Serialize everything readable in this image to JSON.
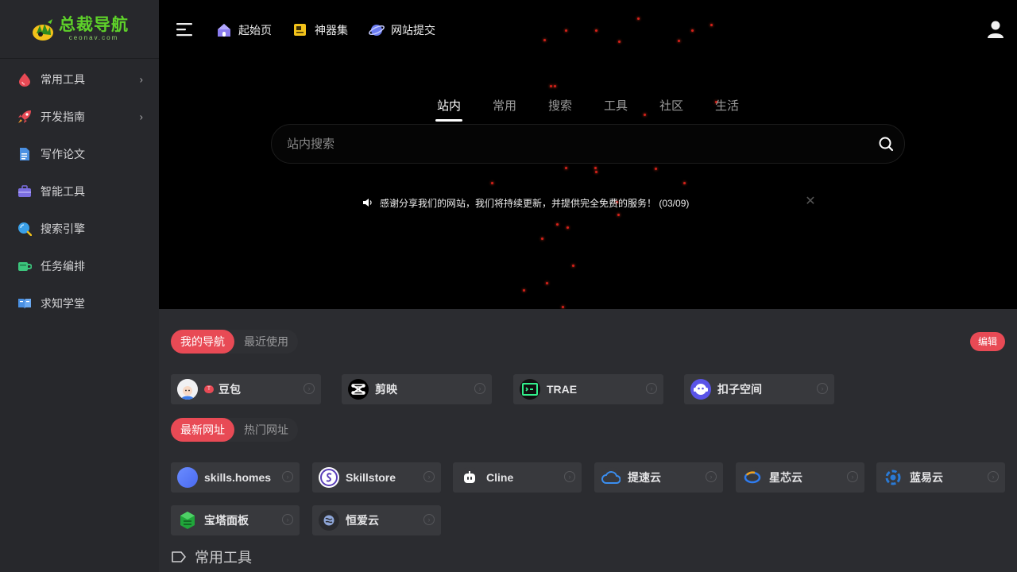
{
  "logo": {
    "title": "总裁导航",
    "subtitle": "ceonav.com"
  },
  "sidebar": {
    "items": [
      {
        "label": "常用工具",
        "icon": "drop-icon",
        "color": "#e84a55",
        "has_submenu": true
      },
      {
        "label": "开发指南",
        "icon": "rocket-icon",
        "color": "#e84a55",
        "has_submenu": true
      },
      {
        "label": "写作论文",
        "icon": "document-icon",
        "color": "#4a90e2",
        "has_submenu": false
      },
      {
        "label": "智能工具",
        "icon": "toolbox-icon",
        "color": "#7b6ee0",
        "has_submenu": false
      },
      {
        "label": "搜索引擎",
        "icon": "search-globe-icon",
        "color": "#3aa0e8",
        "has_submenu": false
      },
      {
        "label": "任务编排",
        "icon": "cup-icon",
        "color": "#3cc47c",
        "has_submenu": false
      },
      {
        "label": "求知学堂",
        "icon": "book-icon",
        "color": "#4a90e2",
        "has_submenu": false
      }
    ]
  },
  "topbar": {
    "links": [
      {
        "label": "起始页",
        "icon": "home-icon"
      },
      {
        "label": "神器集",
        "icon": "folder-icon"
      },
      {
        "label": "网站提交",
        "icon": "planet-icon"
      }
    ]
  },
  "search": {
    "tabs": [
      "站内",
      "常用",
      "搜索",
      "工具",
      "社区",
      "生活"
    ],
    "active_tab": "站内",
    "placeholder": "站内搜索"
  },
  "notice": {
    "text": "感谢分享我们的网站，我们将持续更新，并提供完全免费的服务！ (03/09)"
  },
  "my_nav": {
    "tabs": [
      "我的导航",
      "最近使用"
    ],
    "active_tab": "我的导航",
    "edit_label": "编辑",
    "cards": [
      {
        "label": "豆包",
        "icon": "doubao-icon",
        "hot": true
      },
      {
        "label": "剪映",
        "icon": "capcut-icon"
      },
      {
        "label": "TRAE",
        "icon": "trae-icon"
      },
      {
        "label": "扣子空间",
        "icon": "coze-icon"
      }
    ]
  },
  "sites": {
    "tabs": [
      "最新网址",
      "热门网址"
    ],
    "active_tab": "最新网址",
    "cards": [
      {
        "label": "skills.homes",
        "icon": "skills-homes-icon"
      },
      {
        "label": "Skillstore",
        "icon": "skillstore-icon"
      },
      {
        "label": "Cline",
        "icon": "cline-icon"
      },
      {
        "label": "提速云",
        "icon": "cloud-icon"
      },
      {
        "label": "星芯云",
        "icon": "xingxin-icon"
      },
      {
        "label": "蓝易云",
        "icon": "lanyi-icon"
      },
      {
        "label": "宝塔面板",
        "icon": "baota-icon"
      },
      {
        "label": "恒爱云",
        "icon": "hengai-icon"
      }
    ]
  },
  "section": {
    "title": "常用工具",
    "icon": "tag-icon"
  },
  "colors": {
    "accent": "#e84a55",
    "sidebar_bg": "#27282c",
    "content_bg": "#2b2c30",
    "card_bg": "#38393d"
  }
}
